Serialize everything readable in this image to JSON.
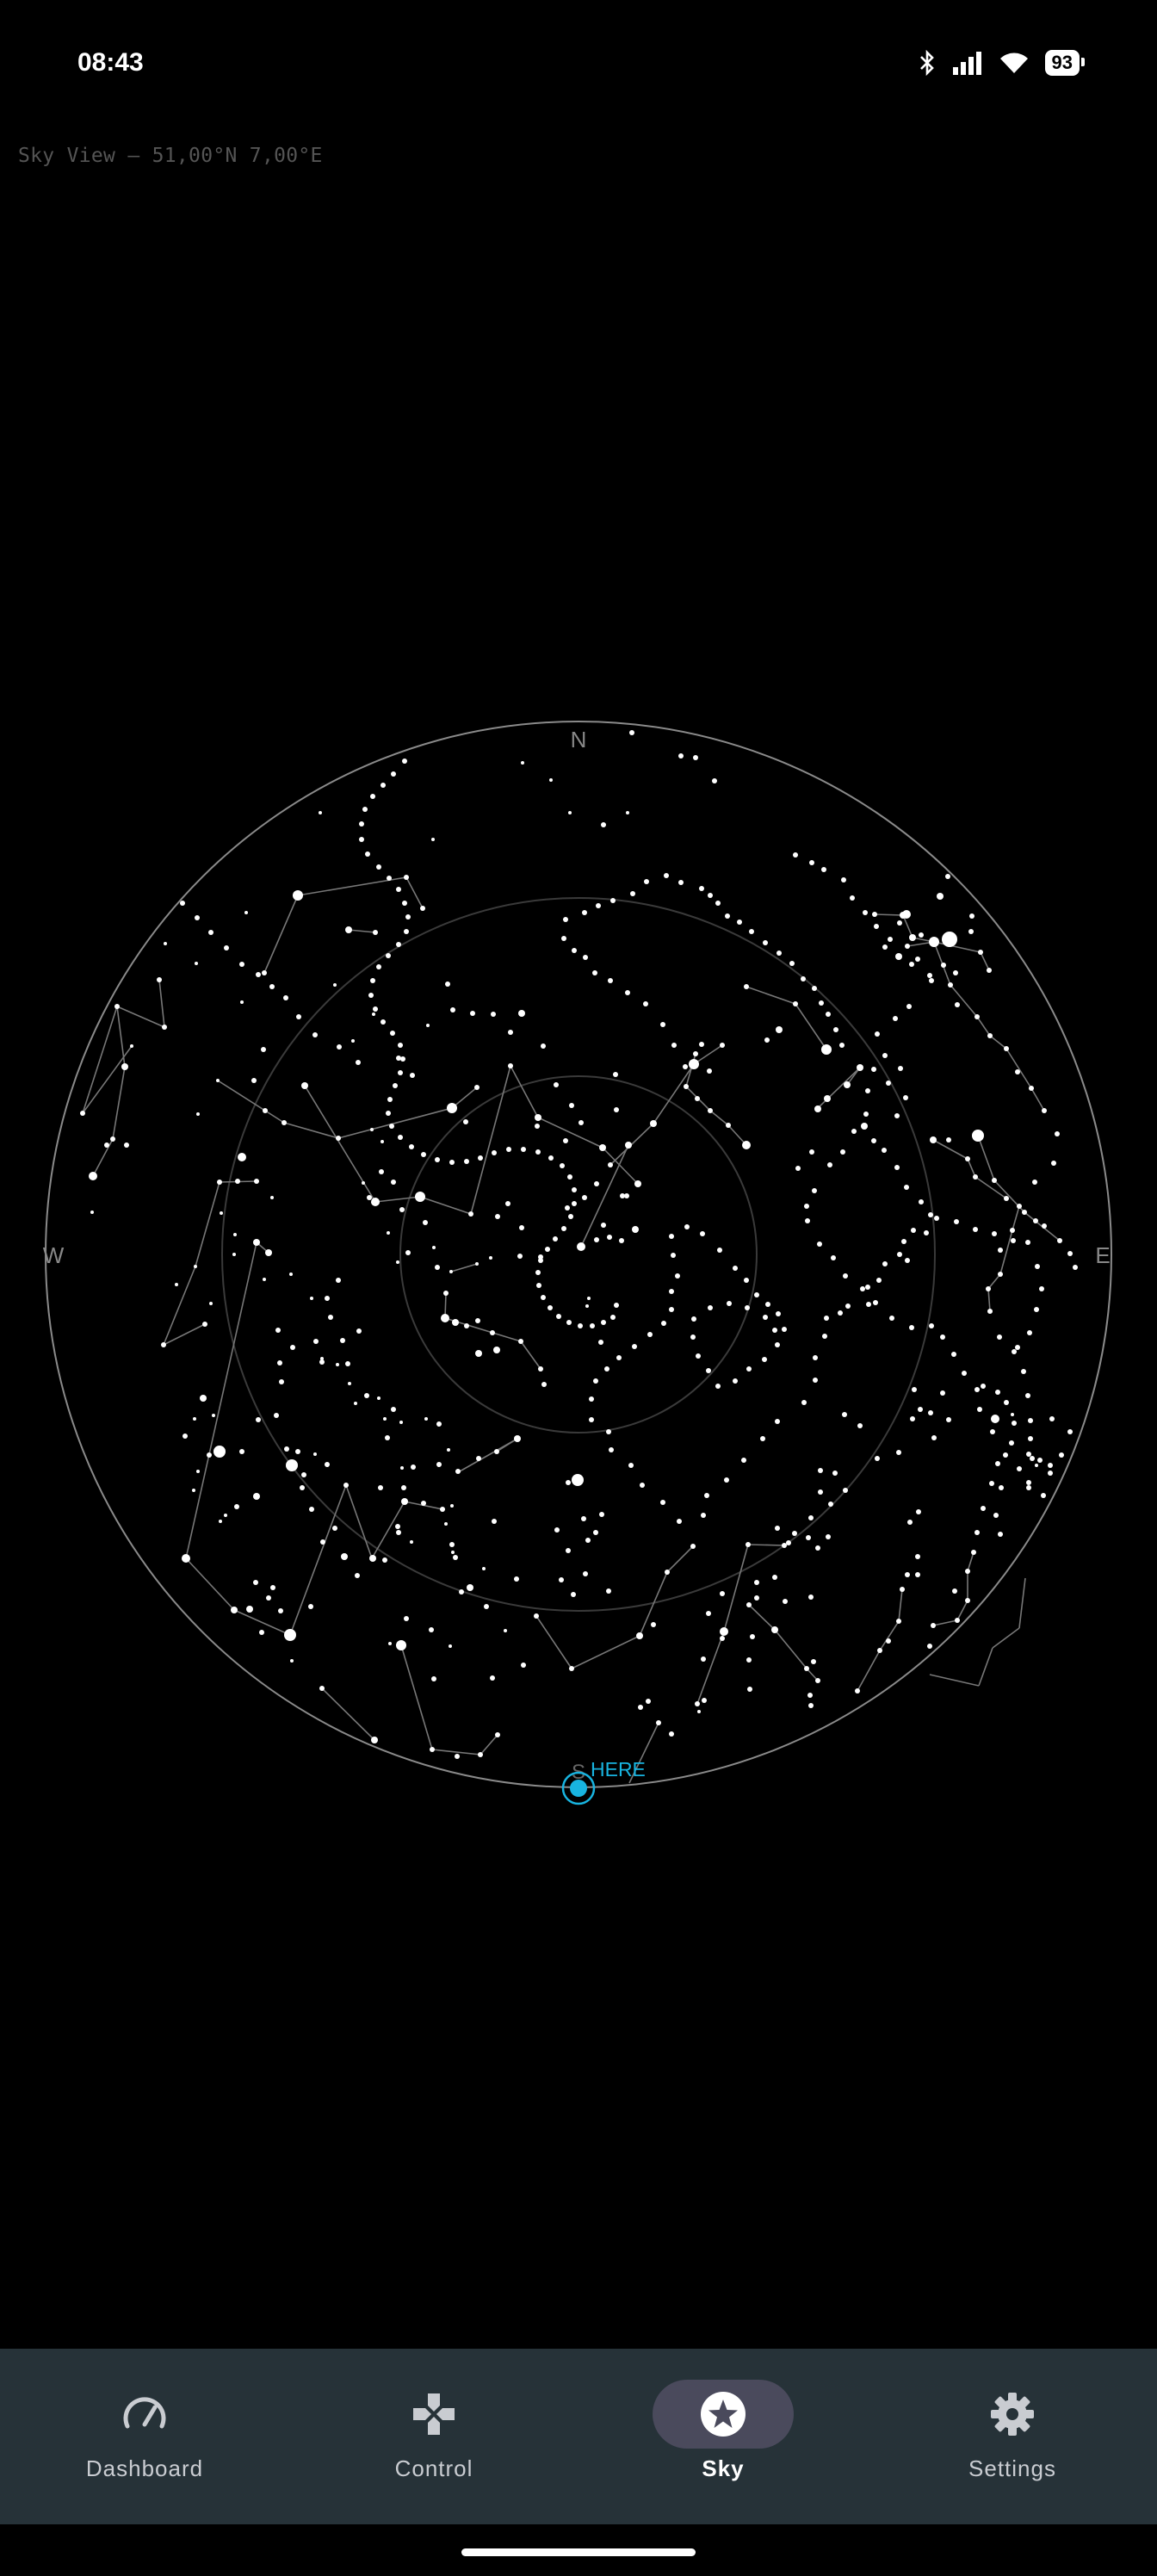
{
  "status": {
    "time": "08:43",
    "battery": "93"
  },
  "sky": {
    "title": "Sky View — 51,00°N 7,00°E",
    "compass": {
      "north": "N",
      "south": "S",
      "east": "E",
      "west": "W"
    },
    "here_label": "HERE",
    "here_color": "#18b4e0"
  },
  "nav": {
    "items": [
      {
        "label": "Dashboard",
        "icon": "speedometer-icon"
      },
      {
        "label": "Control",
        "icon": "gamepad-icon"
      },
      {
        "label": "Sky",
        "icon": "star-icon",
        "active": true
      },
      {
        "label": "Settings",
        "icon": "gear-icon"
      }
    ]
  }
}
